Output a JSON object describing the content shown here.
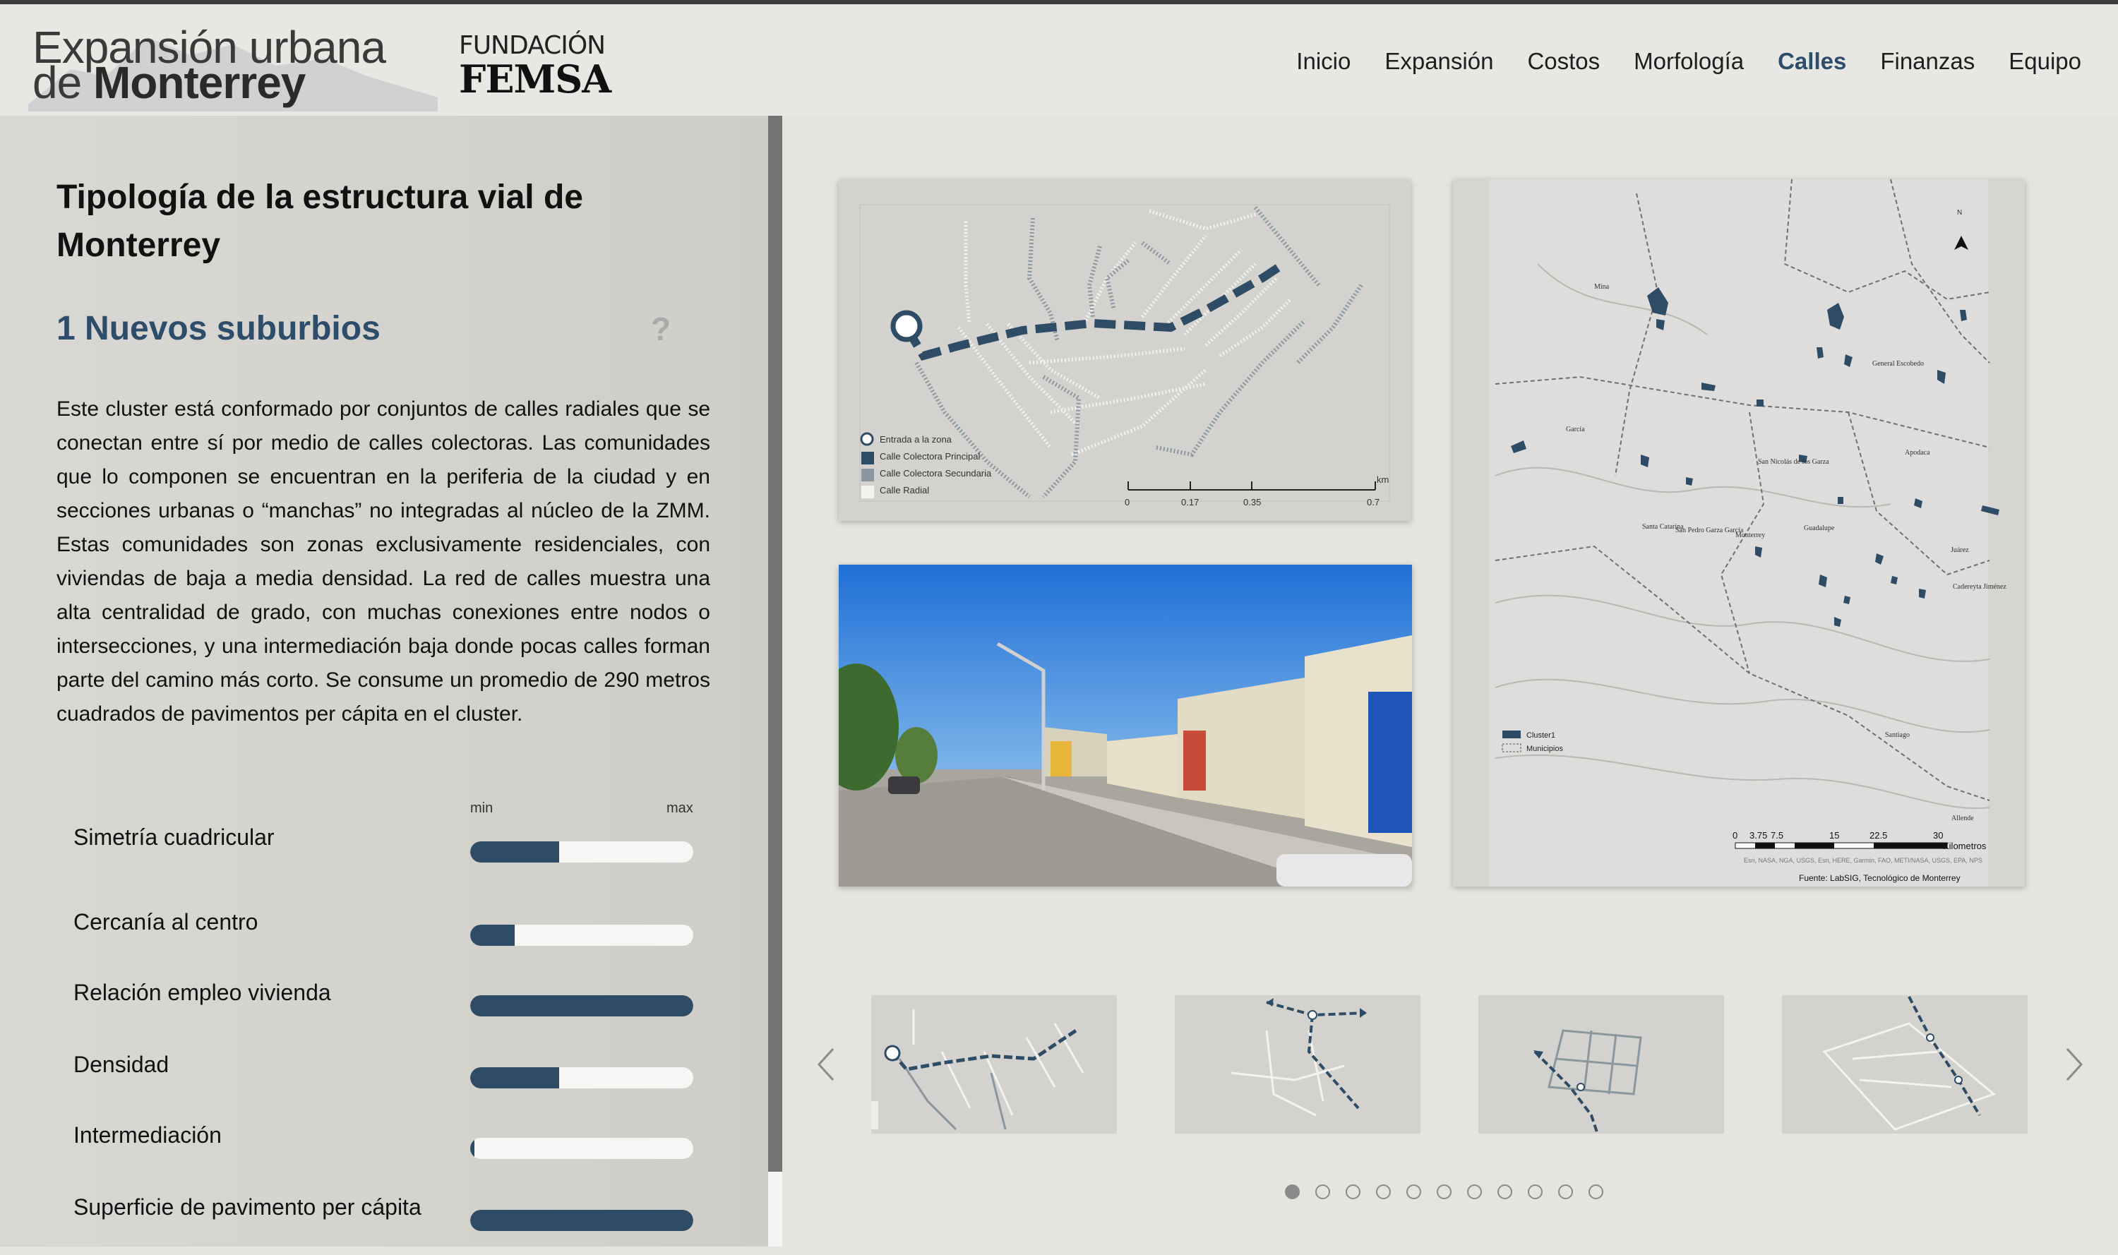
{
  "brand": {
    "title_line1": "Expansión urbana",
    "title_line2_prefix": "de ",
    "title_line2_bold": "Monterrey",
    "sponsor_line1": "FUNDACIÓN",
    "sponsor_line2": "FEMSA"
  },
  "nav": [
    {
      "label": "Inicio"
    },
    {
      "label": "Expansión"
    },
    {
      "label": "Costos"
    },
    {
      "label": "Morfología"
    },
    {
      "label": "Calles",
      "active": true
    },
    {
      "label": "Finanzas"
    },
    {
      "label": "Equipo"
    }
  ],
  "sidebar": {
    "title": "Tipología de la estructura vial de Monterrey",
    "cluster_name": "1 Nuevos suburbios",
    "help_label": "?",
    "description": "Este cluster está conformado por conjuntos de calles radiales que se conectan entre sí por medio de calles colectoras. Las comunidades que lo componen se encuentran en la periferia de la ciudad y en secciones urbanas o “manchas” no integradas al núcleo de la ZMM. Estas comunidades son zonas exclusivamente residenciales, con viviendas de baja a media densidad. La red de calles muestra una alta centralidad de grado, con muchas conexiones entre nodos o intersecciones, y una intermediación baja donde pocas calles forman parte del camino más corto. Se consume un promedio de 290 metros cuadrados de pavimentos per cápita en el cluster.",
    "min_label": "min",
    "max_label": "max",
    "metrics": [
      {
        "label": "Simetría cuadricular",
        "value": 0.4
      },
      {
        "label": "Cercanía al centro",
        "value": 0.2
      },
      {
        "label": "Relación empleo vivienda",
        "value": 1.0
      },
      {
        "label": "Densidad",
        "value": 0.4
      },
      {
        "label": "Intermediación",
        "value": 0.02
      },
      {
        "label": "Superficie de pavimento per cápita",
        "value": 1.0
      }
    ]
  },
  "street_map": {
    "legend": [
      "Entrada a la zona",
      "Calle Colectora Principal",
      "Calle Colectora Secundaria",
      "Calle Radial"
    ],
    "scale_ticks": [
      "0",
      "0.17",
      "0.35",
      "0.7"
    ],
    "scale_unit": "km",
    "colors": {
      "principal": "#2f4c66",
      "secundaria": "#8b979f",
      "radial": "#f2f2f0"
    }
  },
  "region_map": {
    "north_label": "N",
    "places": [
      "Mina",
      "García",
      "Monterrey",
      "Apodaca",
      "Guadalupe",
      "Juárez",
      "Santiago",
      "San Nicolás de los Garza",
      "San Pedro Garza García",
      "Santa Catarina",
      "Cadereyta Jiménez",
      "General Escobedo",
      "Allende"
    ],
    "legend": [
      "Cluster1",
      "Municipios"
    ],
    "scale_ticks": [
      "0",
      "3.75",
      "7.5",
      "15",
      "22.5",
      "30"
    ],
    "scale_unit": "Kilometros",
    "credits": "Esri, NASA, NGA, USGS, Esri, HERE, Garmin, FAO, METI/NASA, USGS, EPA, NPS",
    "source": "Fuente: LabSIG, Tecnológico de Monterrey",
    "cluster_color": "#2f4c66"
  },
  "carousel": {
    "thumb_count": 4,
    "dots_total": 11,
    "active_dot": 1
  }
}
